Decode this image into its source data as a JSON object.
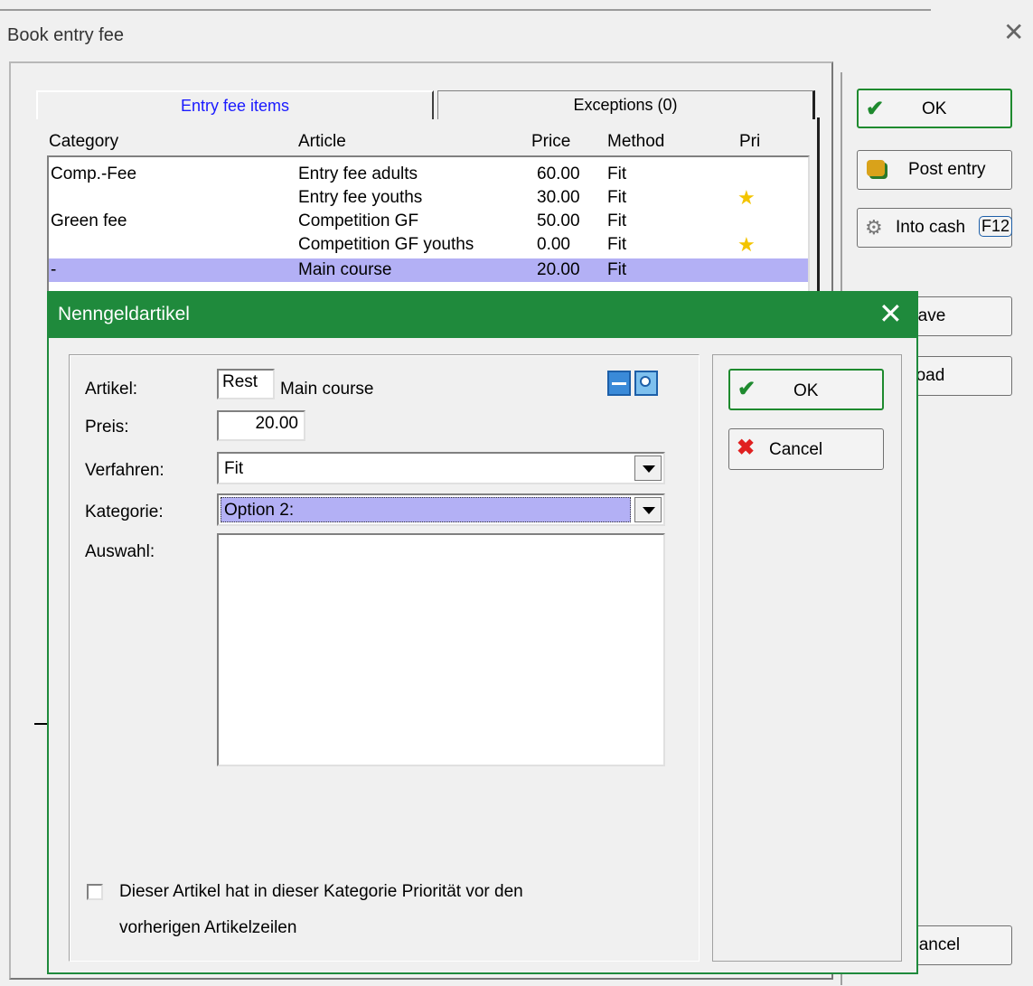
{
  "window": {
    "title": "Book entry fee"
  },
  "tabs": [
    {
      "label": "Entry fee items"
    },
    {
      "label": "Exceptions (0)"
    }
  ],
  "table": {
    "headers": {
      "category": "Category",
      "article": "Article",
      "price": "Price",
      "method": "Method",
      "pri": "Pri"
    },
    "rows": [
      {
        "category": "Comp.-Fee",
        "article": "Entry fee adults",
        "price": "60.00",
        "method": "Fit",
        "pri": false
      },
      {
        "category": "",
        "article": "Entry fee youths",
        "price": "30.00",
        "method": "Fit",
        "pri": true
      },
      {
        "category": "Green fee",
        "article": "Competition GF",
        "price": "50.00",
        "method": "Fit",
        "pri": false
      },
      {
        "category": "",
        "article": "Competition GF youths",
        "price": "0.00",
        "method": "Fit",
        "pri": true
      },
      {
        "category": "-",
        "article": "Main course",
        "price": "20.00",
        "method": "Fit",
        "pri": false,
        "selected": true
      }
    ]
  },
  "right_buttons": {
    "ok": "OK",
    "post_entry": "Post entry",
    "into_cash": "Into cash",
    "into_cash_key": "F12",
    "save": "Save",
    "load": "Load",
    "cancel": "Cancel"
  },
  "dialog": {
    "title": "Nenngeldartikel",
    "artikel_label": "Artikel:",
    "artikel_code": "Rest",
    "artikel_name": "Main course",
    "preis_label": "Preis:",
    "preis_value": "20.00",
    "verfahren_label": "Verfahren:",
    "verfahren_value": "Fit",
    "kategorie_label": "Kategorie:",
    "kategorie_value": "Option 2:",
    "auswahl_label": "Auswahl:",
    "priority_line1": "Dieser Artikel hat in dieser Kategorie Priorität vor den",
    "priority_line2": "vorherigen Artikelzeilen",
    "priority_checked": false,
    "ok_label": "OK",
    "cancel_label": "Cancel"
  },
  "colors": {
    "dialog_title_bg": "#1f8a3c",
    "selected_row": "#b3b0f5",
    "active_tab_text": "#1a1aff"
  }
}
